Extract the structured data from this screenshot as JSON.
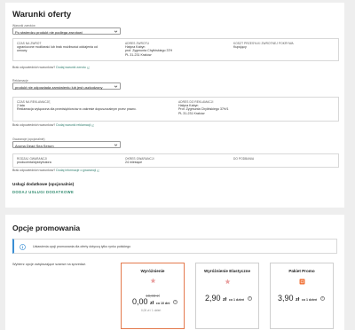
{
  "offer": {
    "title": "Warunki oferty",
    "returns": {
      "field_label": "Warunki zwrotów",
      "value": "Po stwierdzu produkt nie podlega zwrotowi",
      "col1_head": "Czas na zwrot",
      "col1_value": "ograniczone możliwość lub brak możliwości oddajenia od umowy",
      "col2_head": "Adres zwrotu",
      "col2_value": [
        "Halyna Kabyn",
        "prof. Zygmunta Chylińskiego 37H",
        "PL 31-231 Kraków"
      ],
      "col3_head": "Koszt przesyłki zwrotnej pokrywa",
      "col3_value": "Kupujący",
      "note": "Brak odpowiednich warunków?",
      "link": "Dodaj warunki zwrotu"
    },
    "complaint": {
      "field_label": "Reklamacje",
      "value": "produkt nie odpowiada zamówieniu lub jest uszkodzony",
      "col1_head": "Czas na reklamację",
      "col1_value": [
        "2 lata",
        "Reklamacja wyłączona dla przedsiębiorców w zakresie dopuszczalnym przez prawo."
      ],
      "col2_head": "Adres do reklamacji",
      "col2_value": [
        "Halyna Kabyn",
        "Prof. Zygmunta Chylińskiego 37H/1",
        "PL 31-231 Kraków"
      ],
      "note": "Brak odpowiednich warunków?",
      "link": "Dodaj warunki reklamacji"
    },
    "warranty": {
      "field_label": "Gwarancje (opcjonalnie)",
      "value": "Aroma Dead Sea Serum",
      "col1_head": "Rodzaj gwarancji",
      "col1_value": "producenta/dystrybutora",
      "col2_head": "Okres gwarancji",
      "col2_value": "24 miesiące",
      "col3_head": "Do podbania",
      "col3_value": "",
      "note": "Brak odpowiednich warunków?",
      "link": "Dodaj informacje o gwarancji"
    },
    "services": {
      "title": "Usługi dodatkowe (opcjonalnie)",
      "cta": "DODAJ USŁUGI DODATKOWE"
    }
  },
  "promo": {
    "title": "Opcje promowania",
    "info": "Ustawienia opcji promowania dla oferty dotyczą tylko rynku polskiego",
    "lead": "Wybierz opcje zwiększające szanse na sprzedaż.",
    "options": [
      {
        "name": "Wyróżnienie",
        "old_price": "19,00 zł",
        "price": "0,00",
        "currency": "zł",
        "period": "co 10 dni",
        "sub": "0,00 zł / 1 dzień",
        "selected": true
      },
      {
        "name": "Wyróżnienie Elastyczne",
        "price": "2,90",
        "currency": "zł",
        "period": "co 1 dzień",
        "selected": false
      },
      {
        "name": "Pakiet Promo",
        "price": "3,90",
        "currency": "zł",
        "period": "co 1 dzień",
        "selected": false
      }
    ]
  },
  "colors": {
    "accent": "#2f7d6d",
    "selected_border": "#e47a4e",
    "info_border": "#3a8fd4",
    "star": "#e9a0a0",
    "package": "#f06a2b"
  }
}
